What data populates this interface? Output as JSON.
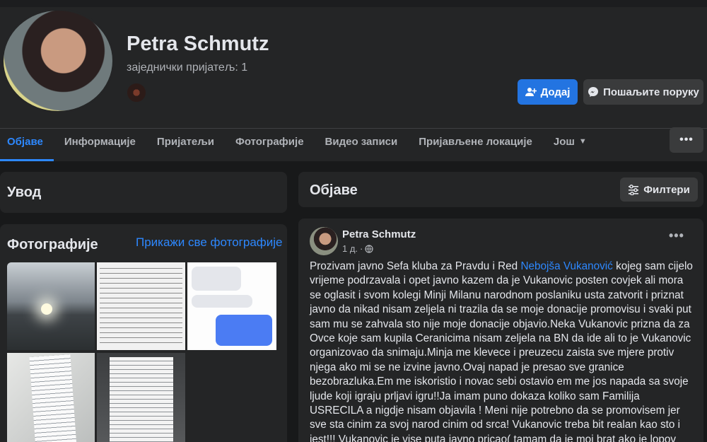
{
  "profile": {
    "name": "Petra Schmutz",
    "mutual_friends": "заједнички пријатељ: 1"
  },
  "actions": {
    "add_label": "Додај",
    "message_label": "Пошаљите поруку"
  },
  "tabs": [
    {
      "label": "Објаве"
    },
    {
      "label": "Информације"
    },
    {
      "label": "Пријатељи"
    },
    {
      "label": "Фотографије"
    },
    {
      "label": "Видео записи"
    },
    {
      "label": "Пријављене локације"
    },
    {
      "label": "Још"
    }
  ],
  "more_label": "•••",
  "intro": {
    "title": "Увод"
  },
  "photos": {
    "title": "Фотографије",
    "see_all": "Прикажи све фотографије"
  },
  "posts": {
    "title": "Објаве",
    "filter_label": "Филтери"
  },
  "post": {
    "author": "Petra Schmutz",
    "time": "1 д.",
    "menu": "•••",
    "text_before": "Prozivam javno Sefa kluba za Pravdu i Red ",
    "mention": "Nebojša Vukanović",
    "text_after": " kojeg sam cijelo vrijeme podrzavala i opet javno kazem da je Vukanovic posten covjek ali mora se oglasit i svom kolegi Minji Milanu narodnom poslaniku usta zatvorit i priznat javno da nikad nisam zeljela ni trazila da se moje donacije promovisu i svaki put sam mu se zahvala sto nije moje donacije objavio.Neka Vukanovic prizna da za Ovce koje sam kupila Ceranicima nisam zeljela na BN da ide ali to je Vukanovic organizovao da snimaju.Minja me klevece i preuzecu zaista sve mjere protiv njega ako mi se ne izvine javno.Ovaj napad je presao sve granice bezobrazluka.Em me iskoristio i novac sebi ostavio em me jos napada sa svoje ljude koji igraju prljavi igru!!Ja imam puno dokaza koliko sam Familija USRECILA a nigdje nisam objavila ! Meni nije potrebno da se promovisem jer sve sta cinim za svoj narod cinim od srca! Vukanovic treba bit realan kao sto i jest!!! Vukanovic je vise puta javno pricao( tamam da je moj brat ako je lopov prijavicu ga) Ovo je vise nego tuzno sta se desava"
  },
  "colors": {
    "accent": "#2d88ff",
    "primary_button": "#2374e1",
    "card": "#242526",
    "background": "#18191a"
  }
}
